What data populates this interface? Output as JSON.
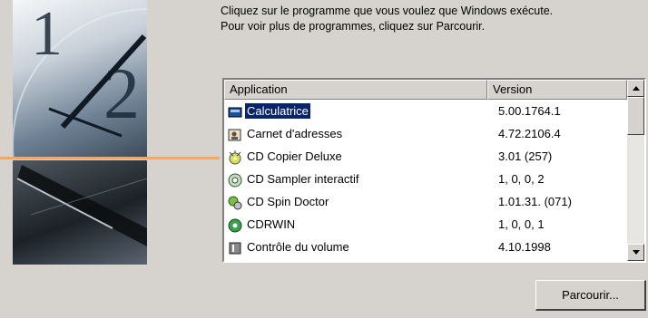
{
  "instructions": {
    "line1": "Cliquez sur le programme que vous voulez que Windows exécute.",
    "line2": "Pour voir plus de programmes, cliquez sur Parcourir."
  },
  "table": {
    "columns": {
      "application": "Application",
      "version": "Version"
    },
    "rows": [
      {
        "name": "Calculatrice",
        "version": "5.00.1764.1",
        "icon": "calculator-icon",
        "selected": true
      },
      {
        "name": "Carnet d'adresses",
        "version": "4.72.2106.4",
        "icon": "address-book-icon",
        "selected": false
      },
      {
        "name": "CD Copier Deluxe",
        "version": "3.01 (257)",
        "icon": "cd-copier-icon",
        "selected": false
      },
      {
        "name": "CD Sampler interactif",
        "version": "1, 0, 0, 2",
        "icon": "cd-sampler-icon",
        "selected": false
      },
      {
        "name": "CD Spin Doctor",
        "version": "1.01.31. (071)",
        "icon": "cd-spin-doctor-icon",
        "selected": false
      },
      {
        "name": "CDRWIN",
        "version": "1, 0, 0, 1",
        "icon": "cdrwin-icon",
        "selected": false
      },
      {
        "name": "Contrôle du volume",
        "version": "4.10.1998",
        "icon": "volume-control-icon",
        "selected": false
      }
    ]
  },
  "browse_button": {
    "label": "Parcourir..."
  },
  "colors": {
    "dialog_bg": "#d6d3ce",
    "selection": "#0a246a",
    "connector": "#f5a662"
  }
}
